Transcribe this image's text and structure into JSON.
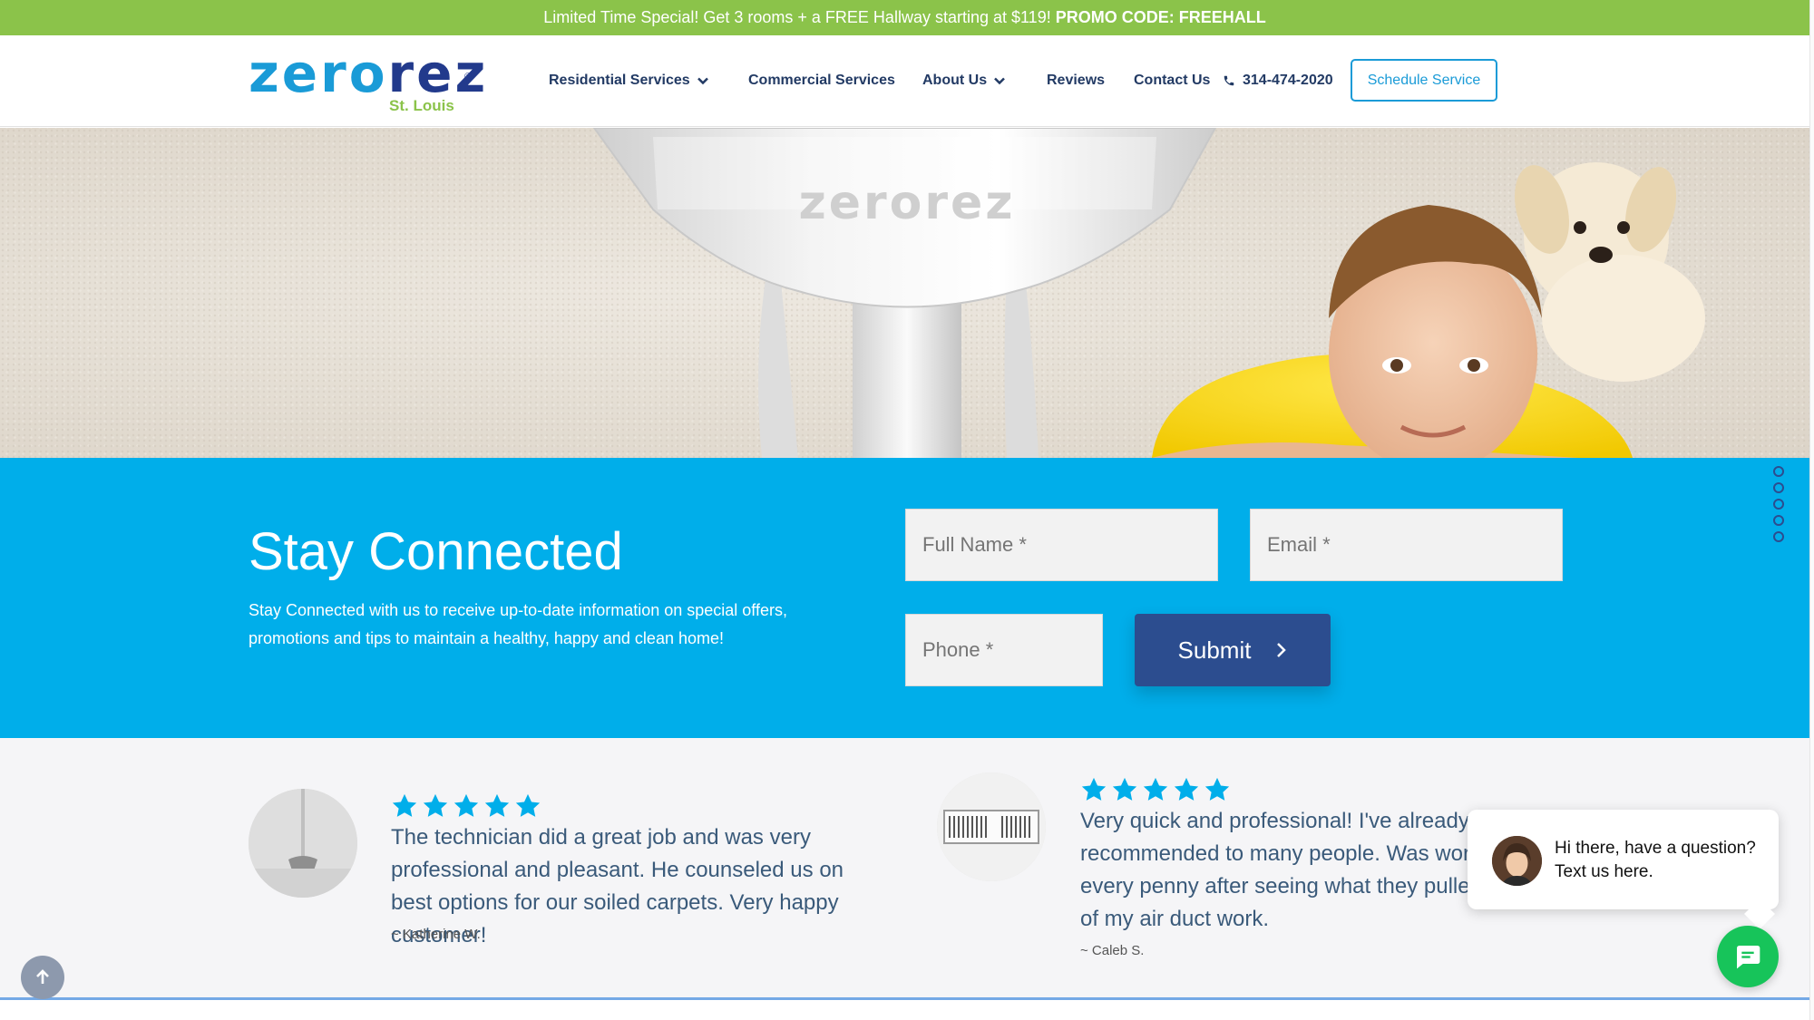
{
  "promo": {
    "text": "Limited Time Special! Get 3 rooms + a FREE Hallway starting at $119!",
    "code": "PROMO CODE: FREEHALL"
  },
  "brand": {
    "logo_part1": "zero",
    "logo_part2": "rez",
    "logo_reg": "®",
    "city": "St. Louis",
    "primary_color": "#1a9bd7",
    "navy_color": "#223a8c",
    "green_color": "#8bc34a"
  },
  "nav": {
    "residential": "Residential Services",
    "commercial": "Commercial Services",
    "about": "About Us",
    "reviews": "Reviews",
    "contact": "Contact Us",
    "phone": "314-474-2020",
    "schedule": "Schedule Service"
  },
  "hero": {
    "wand_brand": "zerorez"
  },
  "stay_connected": {
    "title": "Stay Connected",
    "description": "Stay Connected with us to receive up-to-date information on special offers, promotions and tips to maintain a healthy, happy and clean home!",
    "full_name_placeholder": "Full Name *",
    "email_placeholder": "Email *",
    "phone_placeholder": "Phone *",
    "submit_label": "Submit",
    "background_color": "#00aeea"
  },
  "reviews": [
    {
      "rating": 5,
      "text": "The technician did a great job and was very professional and pleasant. He counseled us on best options for our soiled carpets. Very happy customer!",
      "author": "~ Katherine W.",
      "image": "carpet-wand-image"
    },
    {
      "rating": 5,
      "text": "Very quick and professional! I've already recommended to many people. Was worth every penny after seeing what they pulled out of my air duct work.",
      "author": "~ Caleb S.",
      "image": "air-vent-image"
    }
  ],
  "chat": {
    "message": "Hi there, have a question? Text us here.",
    "button_color": "#17c45a"
  }
}
